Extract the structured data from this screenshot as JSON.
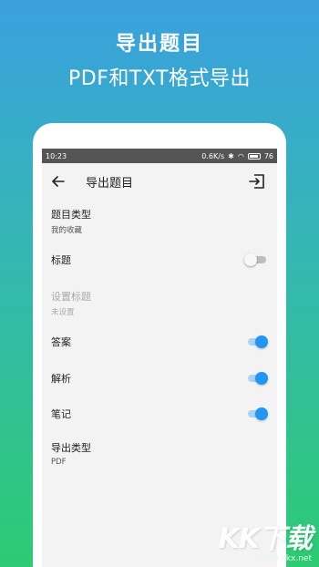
{
  "promo": {
    "title": "导出题目",
    "subtitle": "PDF和TXT格式导出"
  },
  "status_bar": {
    "time": "10:23",
    "speed": "0.6K/s",
    "battery": "76"
  },
  "app_bar": {
    "title": "导出题目"
  },
  "settings": {
    "question_type_label": "题目类型",
    "question_type_value": "我的收藏",
    "title_label": "标题",
    "set_title_label": "设置标题",
    "set_title_value": "未设置",
    "answer_label": "答案",
    "analysis_label": "解析",
    "notes_label": "笔记",
    "export_type_label": "导出类型",
    "export_type_value": "PDF"
  },
  "toggles": {
    "title": false,
    "answer": true,
    "analysis": true,
    "notes": true
  },
  "watermark": {
    "big": "KK下载",
    "small": "www.kkx.net"
  },
  "colors": {
    "accent": "#2196f3",
    "gradient_top": "#3aa0df",
    "gradient_bottom": "#2dcb73"
  }
}
